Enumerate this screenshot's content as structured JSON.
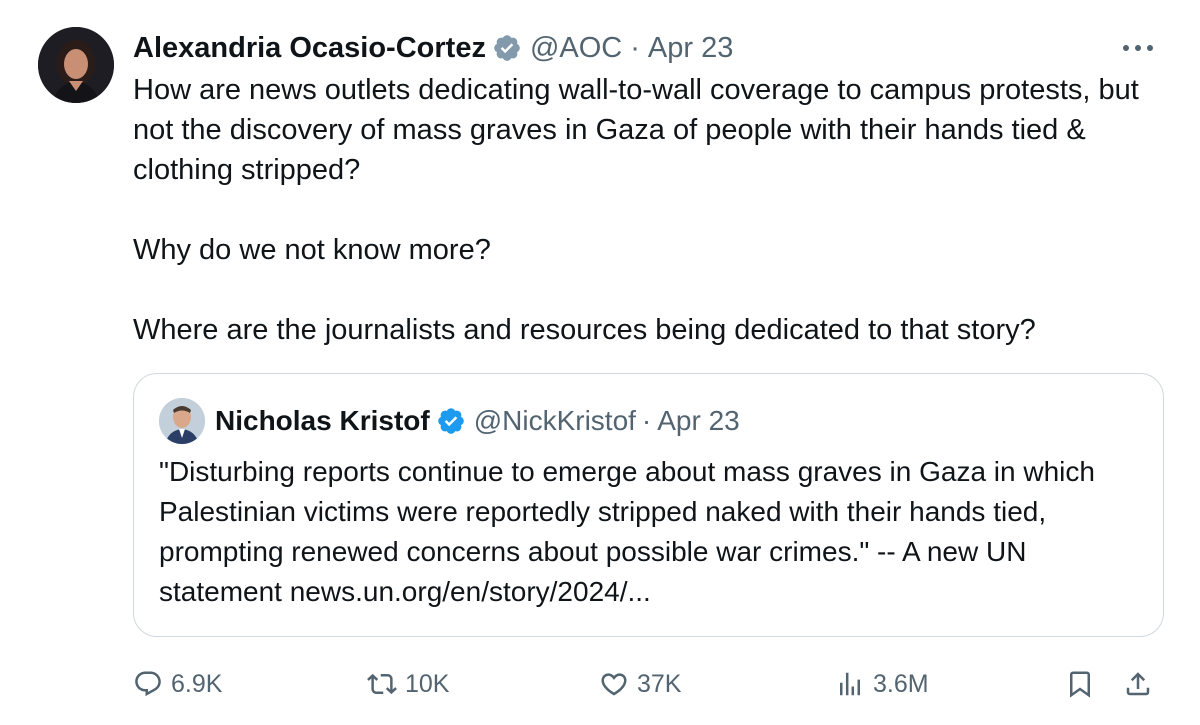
{
  "author": {
    "name": "Alexandria Ocasio-Cortez",
    "handle": "@AOC",
    "date": "Apr 23",
    "separator": "·"
  },
  "tweet": {
    "paragraphs": [
      "How are news outlets dedicating wall-to-wall coverage to campus protests, but not the discovery of mass graves in Gaza of people with their hands tied & clothing stripped?",
      "Why do we not know more?",
      "Where are the journalists and resources being dedicated to that story?"
    ]
  },
  "quote": {
    "name": "Nicholas Kristof",
    "handle": "@NickKristof",
    "date": "Apr 23",
    "separator": "·",
    "text": "\"Disturbing reports continue to emerge about mass graves in Gaza in which Palestinian victims were reportedly stripped naked with their hands tied, prompting renewed concerns about possible war crimes.\" -- A new UN statement news.un.org/en/story/2024/..."
  },
  "actions": {
    "replies": "6.9K",
    "retweets": "10K",
    "likes": "37K",
    "views": "3.6M"
  },
  "icons": {
    "author_badge": "verified-gray-badge-icon",
    "quote_badge": "verified-blue-badge-icon",
    "more": "more-dots-icon",
    "reply": "reply-bubble-icon",
    "retweet": "retweet-icon",
    "like": "heart-icon",
    "views": "views-bars-icon",
    "bookmark": "bookmark-icon",
    "share": "share-upload-icon"
  },
  "colors": {
    "text": "#0f1419",
    "secondary": "#536471",
    "border": "#cfd9de",
    "verified_blue": "#1d9bf0",
    "verified_gray": "#829aab"
  }
}
